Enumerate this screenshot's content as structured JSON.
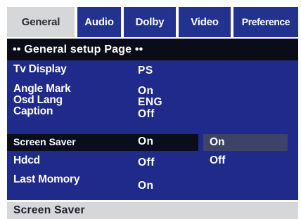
{
  "tabs": {
    "general": "General",
    "audio": "Audio",
    "dolby": "Dolby",
    "video": "Video",
    "preference": "Preference"
  },
  "page_title": "•• General setup Page ••",
  "settings": {
    "tv_display": {
      "label": "Tv Display",
      "value": "PS"
    },
    "angle_mark": {
      "label": "Angle Mark",
      "value": "On"
    },
    "osd_lang": {
      "label": "Osd Lang",
      "value": "ENG"
    },
    "caption": {
      "label": "Caption",
      "value": "Off"
    },
    "screen_saver": {
      "label": "Screen Saver",
      "value": "On"
    },
    "hdcd": {
      "label": "Hdcd",
      "value": "Off"
    },
    "last_memory": {
      "label": "Last Momory",
      "value": "On"
    }
  },
  "submenu": {
    "options": [
      "On",
      "Off"
    ],
    "selected": "On"
  },
  "status": "Screen Saver",
  "colors": {
    "panel": "#1f2a8a",
    "tab_inactive": "#23328f",
    "tab_active": "#d6d7d9",
    "title_bar": "#0a0c18",
    "selection": "#0b0d1c",
    "submenu_highlight": "#3c4366"
  }
}
